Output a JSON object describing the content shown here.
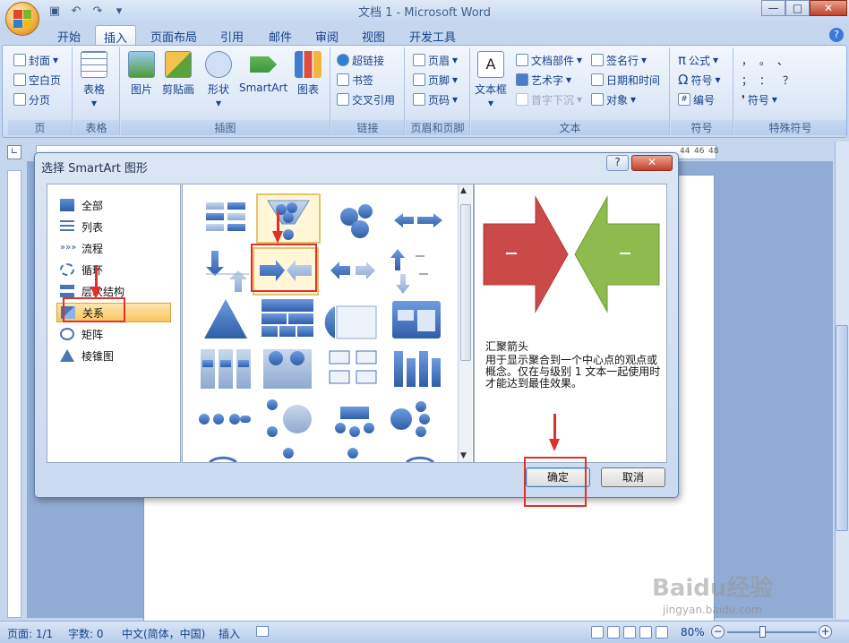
{
  "window": {
    "title": "文档 1 - Microsoft Word",
    "min": "—",
    "max": "□",
    "close": "✕"
  },
  "tabs": [
    "开始",
    "插入",
    "页面布局",
    "引用",
    "邮件",
    "审阅",
    "视图",
    "开发工具"
  ],
  "active_tab": "插入",
  "ribbon": {
    "page_group": {
      "label": "页",
      "items": [
        "封面",
        "空白页",
        "分页"
      ]
    },
    "table_group": {
      "label": "表格",
      "button": "表格"
    },
    "illustrations_group": {
      "label": "插图",
      "buttons": [
        "图片",
        "剪贴画",
        "形状",
        "SmartArt",
        "图表"
      ]
    },
    "links_group": {
      "label": "链接",
      "items": [
        "超链接",
        "书签",
        "交叉引用"
      ]
    },
    "header_footer_group": {
      "label": "页眉和页脚",
      "items": [
        "页眉",
        "页脚",
        "页码"
      ]
    },
    "text_group": {
      "label": "文本",
      "big": "文本框",
      "items": [
        "文档部件",
        "艺术字",
        "首字下沉",
        "签名行",
        "日期和时间",
        "对象"
      ]
    },
    "symbols_group": {
      "label": "符号",
      "items": [
        "公式",
        "符号",
        "编号"
      ]
    },
    "special_group": {
      "label": "特殊符号",
      "symbol_item": "符号"
    }
  },
  "ruler_numbers": [
    "44",
    "46",
    "48"
  ],
  "dialog": {
    "title": "选择 SmartArt 图形",
    "help": "?",
    "close": "✕",
    "categories": [
      "全部",
      "列表",
      "流程",
      "循环",
      "层次结构",
      "关系",
      "矩阵",
      "棱锥图"
    ],
    "selected_category": "关系",
    "preview_name": "汇聚箭头",
    "preview_desc": "用于显示聚合到一个中心点的观点或概念。仅在与级别 1 文本一起使用时才能达到最佳效果。",
    "ok": "确定",
    "cancel": "取消"
  },
  "status": {
    "page": "页面: 1/1",
    "words": "字数: 0",
    "language": "中文(简体，中国)",
    "mode": "插入",
    "zoom": "80%"
  },
  "watermark": {
    "text": "Baidu经验",
    "sub": "jingyan.baidu.com"
  },
  "colors": {
    "accent_red": "#e0302b",
    "ribbon_blue": "#15428b",
    "arrow_red": "#c94a48",
    "arrow_green": "#8dbb4d"
  }
}
